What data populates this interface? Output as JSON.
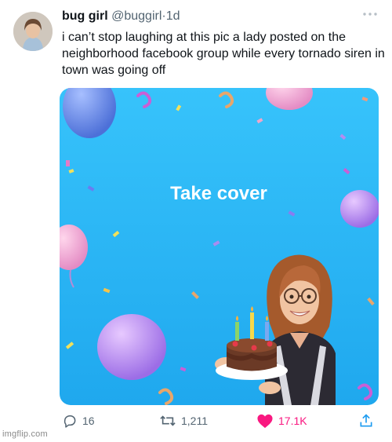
{
  "tweet": {
    "author_name": "bug girl",
    "author_handle": "@buggirl",
    "separator": "·",
    "timestamp": "1d",
    "text": "i can’t stop laughing at this pic a lady posted on the neighborhood facebook group while every tornado siren in town was going off",
    "media": {
      "caption": "Take cover",
      "background_color": "#27b6f4"
    }
  },
  "actions": {
    "replies": "16",
    "retweets": "1,211",
    "likes": "17.1K",
    "like_color": "#f91880",
    "icons": [
      "reply-icon",
      "retweet-icon",
      "like-icon",
      "share-icon"
    ]
  },
  "watermark": "imgflip.com",
  "colors": {
    "accent_blue": "#1d9bf0",
    "secondary_text": "#536471"
  }
}
